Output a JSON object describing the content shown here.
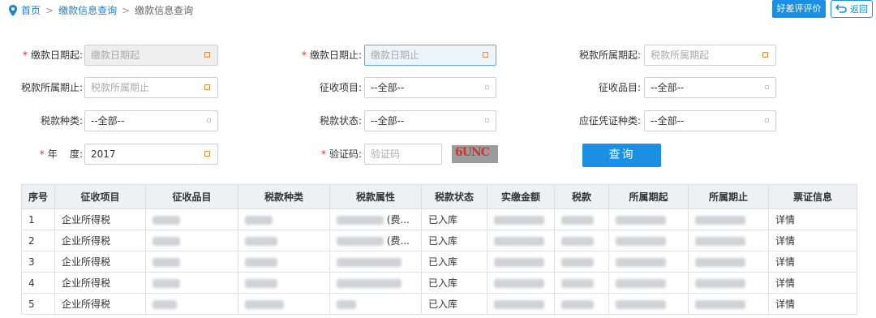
{
  "breadcrumb": {
    "home": "首页",
    "level1": "缴款信息查询",
    "current": "缴款信息查询",
    "separator": ">"
  },
  "toolbar": {
    "review_label": "好差评评价",
    "back_label": "返回"
  },
  "form": {
    "pay_date_start": {
      "label": "缴款日期起:",
      "placeholder": "缴款日期起",
      "required": true
    },
    "pay_date_end": {
      "label": "缴款日期止:",
      "placeholder": "缴款日期止",
      "required": true
    },
    "tax_period_start": {
      "label": "税款所属期起:",
      "placeholder": "税款所属期起"
    },
    "tax_period_end": {
      "label": "税款所属期止:",
      "placeholder": "税款所属期止"
    },
    "levy_item": {
      "label": "征收项目:",
      "value": "--全部--"
    },
    "levy_product": {
      "label": "征收品目:",
      "value": "--全部--"
    },
    "tax_type": {
      "label": "税款种类:",
      "value": "--全部--"
    },
    "tax_status": {
      "label": "税款状态:",
      "value": "--全部--"
    },
    "voucher_type": {
      "label": "应征凭证种类:",
      "value": "--全部--"
    },
    "year": {
      "label": "年    度:",
      "value": "2017",
      "required": true
    },
    "captcha": {
      "label": "验证码:",
      "placeholder": "验证码",
      "required": true,
      "image_text": "6UNC"
    },
    "query_label": "查询"
  },
  "table": {
    "headers": [
      "序号",
      "征收项目",
      "征收品目",
      "税款种类",
      "税款属性",
      "税款状态",
      "实缴金额",
      "税款",
      "所属期起",
      "所属期止",
      "票证信息"
    ],
    "rows": [
      {
        "no": "1",
        "levy_item": "企业所得税",
        "attr_suffix": "(费...",
        "status": "已入库",
        "detail": "详情"
      },
      {
        "no": "2",
        "levy_item": "企业所得税",
        "attr_suffix": "(费...",
        "status": "已入库",
        "detail": "详情"
      },
      {
        "no": "3",
        "levy_item": "企业所得税",
        "attr_suffix": "",
        "status": "已入库",
        "detail": "详情"
      },
      {
        "no": "4",
        "levy_item": "企业所得税",
        "attr_suffix": "",
        "status": "已入库",
        "detail": "详情"
      },
      {
        "no": "5",
        "levy_item": "企业所得税",
        "attr_suffix": "",
        "status": "已入库",
        "detail": "详情"
      }
    ]
  },
  "icons": {
    "breadcrumb": "location-pin-icon",
    "back": "return-arrow-icon",
    "date_picker": "calendar-icon",
    "select": "dropdown-icon"
  },
  "colors": {
    "accent": "#1a8fe3",
    "link": "#1e7fd6",
    "required": "#e12b2b",
    "calendar": "#e78a3c"
  }
}
